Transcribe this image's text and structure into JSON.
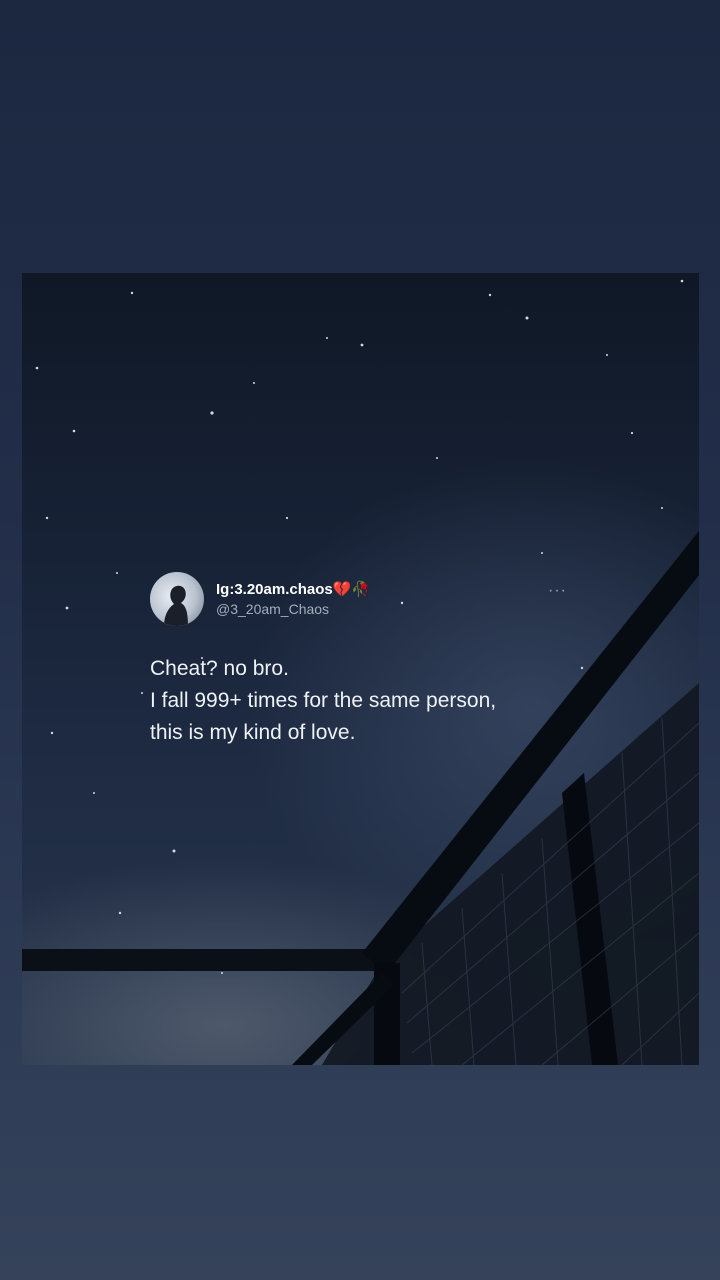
{
  "tweet": {
    "display_name": "Ig:3.20am.chaos💔🥀",
    "handle": "@3_20am_Chaos",
    "more_label": "···",
    "lines": [
      "Cheat? no bro.",
      "I fall 999+ times for the same person,",
      "this is my kind of love."
    ]
  }
}
